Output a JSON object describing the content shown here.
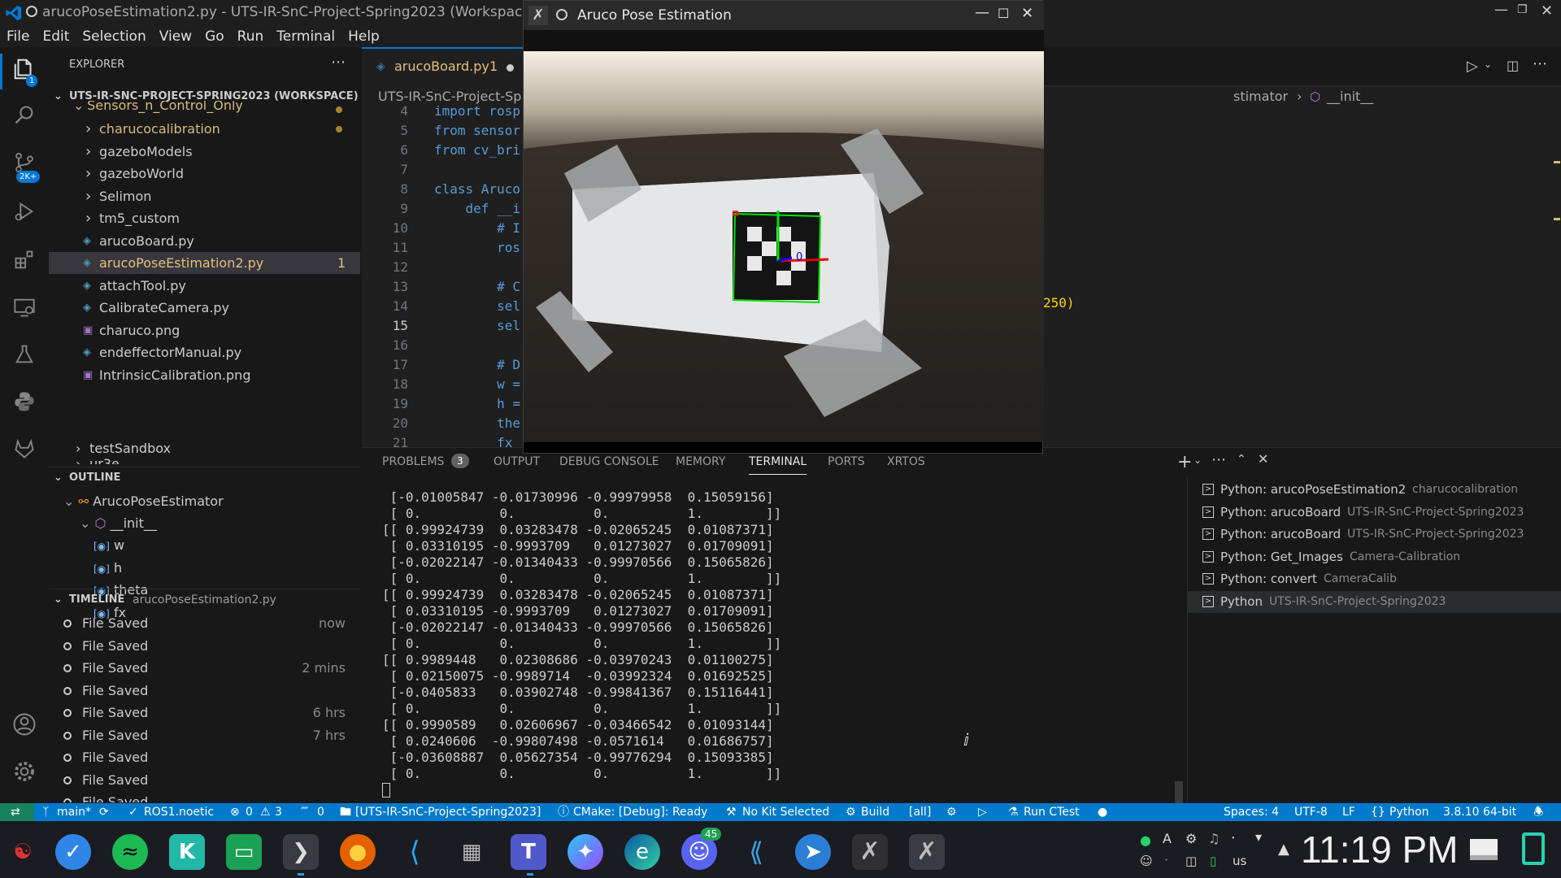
{
  "window_title": "arucoPoseEstimation2.py - UTS-IR-SnC-Project-Spring2023 (Workspace) -",
  "menu": [
    "File",
    "Edit",
    "Selection",
    "View",
    "Go",
    "Run",
    "Terminal",
    "Help"
  ],
  "activity_badges": {
    "explorer": "1",
    "scm": "2K+"
  },
  "explorer": {
    "title": "EXPLORER",
    "workspace": "UTS-IR-SNC-PROJECT-SPRING2023 (WORKSPACE)",
    "parent_folder": "Sensors_n_Control_Only",
    "items": [
      {
        "label": "charucocalibration",
        "kind": "folder",
        "badge": ""
      },
      {
        "label": "gazeboModels",
        "kind": "folder",
        "badge": ""
      },
      {
        "label": "gazeboWorld",
        "kind": "folder",
        "badge": ""
      },
      {
        "label": "Selimon",
        "kind": "folder",
        "badge": ""
      },
      {
        "label": "tm5_custom",
        "kind": "folder",
        "badge": ""
      },
      {
        "label": "arucoBoard.py",
        "kind": "py",
        "badge": ""
      },
      {
        "label": "arucoPoseEstimation2.py",
        "kind": "py",
        "badge": "1"
      },
      {
        "label": "attachTool.py",
        "kind": "py",
        "badge": ""
      },
      {
        "label": "CalibrateCamera.py",
        "kind": "py",
        "badge": ""
      },
      {
        "label": "charuco.png",
        "kind": "img",
        "badge": ""
      },
      {
        "label": "endeffectorManual.py",
        "kind": "py",
        "badge": ""
      },
      {
        "label": "IntrinsicCalibration.png",
        "kind": "img",
        "badge": ""
      }
    ],
    "sibling_folder": "testSandbox",
    "cut_folder": "ur3e"
  },
  "outline": {
    "title": "OUTLINE",
    "class_name": "ArucoPoseEstimator",
    "method": "__init__",
    "fields": [
      "w",
      "h",
      "theta",
      "fx"
    ]
  },
  "timeline": {
    "title": "TIMELINE",
    "file": "arucoPoseEstimation2.py",
    "entries": [
      {
        "label": "File Saved",
        "time": "now"
      },
      {
        "label": "File Saved",
        "time": ""
      },
      {
        "label": "File Saved",
        "time": "2 mins"
      },
      {
        "label": "File Saved",
        "time": ""
      },
      {
        "label": "File Saved",
        "time": "6 hrs"
      },
      {
        "label": "File Saved",
        "time": "7 hrs"
      },
      {
        "label": "File Saved",
        "time": ""
      },
      {
        "label": "File Saved",
        "time": ""
      },
      {
        "label": "File Saved",
        "time": ""
      }
    ]
  },
  "editor": {
    "tab_label": "arucoBoard.py",
    "tab_count": "1",
    "breadcrumb_left": "UTS-IR-SnC-Project-Spri",
    "breadcrumb_right_1": "stimator",
    "breadcrumb_right_2": "__init__",
    "line_numbers": [
      "4",
      "5",
      "6",
      "7",
      "8",
      "9",
      "10",
      "11",
      "12",
      "13",
      "14",
      "15",
      "16",
      "17",
      "18",
      "19",
      "20",
      "21"
    ],
    "code_lines": [
      "import rosp",
      "from sensor",
      "from cv_bri",
      "",
      "class Aruco",
      "    def __i",
      "        # I",
      "        ros",
      "",
      "        # C",
      "        sel",
      "        sel",
      "",
      "        # D",
      "        w =",
      "        h =",
      "        the",
      "        fx"
    ],
    "right_text": "250)"
  },
  "panel": {
    "tabs": [
      "PROBLEMS",
      "OUTPUT",
      "DEBUG CONSOLE",
      "MEMORY",
      "TERMINAL",
      "PORTS",
      "XRTOS"
    ],
    "problems_count": "3",
    "terminal_lines": [
      " [-0.01005847 -0.01730996 -0.99979958  0.15059156]",
      " [ 0.          0.          0.          1.        ]]",
      "[[ 0.99924739  0.03283478 -0.02065245  0.01087371]",
      " [ 0.03310195 -0.9993709   0.01273027  0.01709091]",
      " [-0.02022147 -0.01340433 -0.99970566  0.15065826]",
      " [ 0.          0.          0.          1.        ]]",
      "[[ 0.99924739  0.03283478 -0.02065245  0.01087371]",
      " [ 0.03310195 -0.9993709   0.01273027  0.01709091]",
      " [-0.02022147 -0.01340433 -0.99970566  0.15065826]",
      " [ 0.          0.          0.          1.        ]]",
      "[[ 0.9989448   0.02308686 -0.03970243  0.01100275]",
      " [ 0.02150075 -0.9989714  -0.03992324  0.01692525]",
      " [-0.0405833   0.03902748 -0.99841367  0.15116441]",
      " [ 0.          0.          0.          1.        ]]",
      "[[ 0.9990589   0.02606967 -0.03466542  0.01093144]",
      " [ 0.0240606  -0.99807498 -0.0571614   0.01686757]",
      " [-0.03608887  0.05627354 -0.99776294  0.15093385]",
      " [ 0.          0.          0.          1.        ]]"
    ],
    "terminal_list": [
      {
        "name": "Python: arucoPoseEstimation2",
        "dir": "charucocalibration"
      },
      {
        "name": "Python: arucoBoard",
        "dir": "UTS-IR-SnC-Project-Spring2023"
      },
      {
        "name": "Python: arucoBoard",
        "dir": "UTS-IR-SnC-Project-Spring2023"
      },
      {
        "name": "Python: Get_Images",
        "dir": "Camera-Calibration"
      },
      {
        "name": "Python: convert",
        "dir": "CameraCalib"
      },
      {
        "name": "Python",
        "dir": "UTS-IR-SnC-Project-Spring2023"
      }
    ]
  },
  "status": {
    "branch": "main*",
    "ros": "ROS1.noetic",
    "errors": "0",
    "warnings": "3",
    "ports": "0",
    "workspace": "[UTS-IR-SnC-Project-Spring2023]",
    "cmake": "CMake: [Debug]: Ready",
    "kit": "No Kit Selected",
    "build": "Build",
    "all": "[all]",
    "ctest": "Run CTest",
    "spaces": "Spaces: 4",
    "encoding": "UTF-8",
    "eol": "LF",
    "language": "Python",
    "interpreter": "3.8.10 64-bit"
  },
  "popup": {
    "title": "Aruco Pose Estimation",
    "axis_label": "0"
  },
  "taskbar": {
    "discord_badge": "45",
    "keyboard_layout": "us",
    "clock": "11:19 PM"
  },
  "colors": {
    "accent": "#007acc",
    "folder_modified": "#d7ba7d",
    "file_error": "#e5c07b",
    "keyword": "#569cd6"
  }
}
